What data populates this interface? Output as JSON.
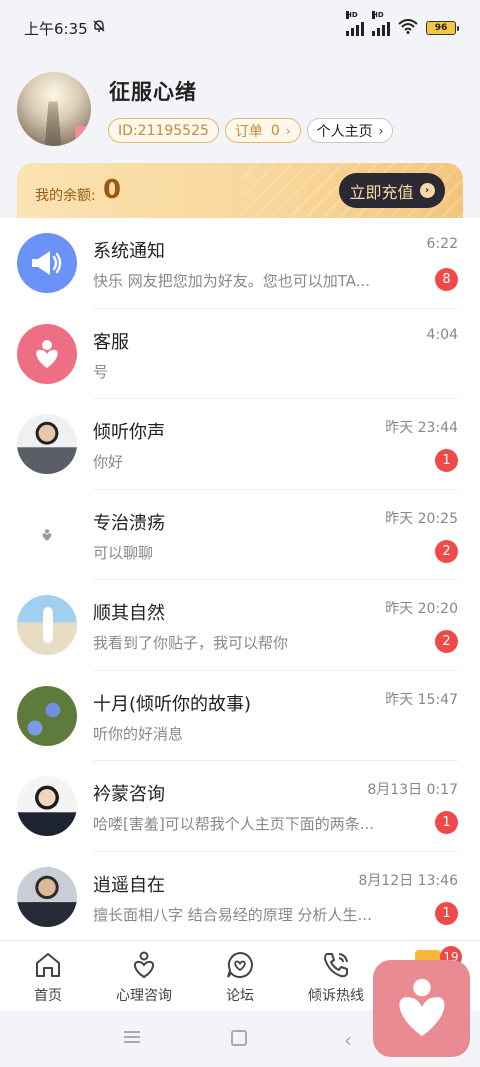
{
  "status_bar": {
    "time": "上午6:35",
    "network_1": "HD",
    "network_2": "HD",
    "battery": "96"
  },
  "profile": {
    "nickname": "征服心绪",
    "id_label": "ID:21195525",
    "order_label": "订单",
    "order_count": "0",
    "homepage_label": "个人主页"
  },
  "balance": {
    "label": "我的余额:",
    "value": "0",
    "recharge_label": "立即充值"
  },
  "conversations": [
    {
      "name": "系统通知",
      "time": "6:22",
      "preview": "快乐 网友把您加为好友。您也可以加TA...",
      "unread": "8",
      "avatar_icon": "megaphone-icon"
    },
    {
      "name": "客服",
      "time": "4:04",
      "preview": "号",
      "unread": "",
      "avatar_icon": "heart-person-icon"
    },
    {
      "name": "倾听你声",
      "time": "昨天 23:44",
      "preview": "你好",
      "unread": "1",
      "avatar_icon": "user-photo"
    },
    {
      "name": "专治溃疡",
      "time": "昨天 20:25",
      "preview": "可以聊聊",
      "unread": "2",
      "avatar_icon": "heart-person-icon"
    },
    {
      "name": "顺其自然",
      "time": "昨天 20:20",
      "preview": "我看到了你贴子，我可以帮你",
      "unread": "2",
      "avatar_icon": "user-photo"
    },
    {
      "name": "十月(倾听你的故事)",
      "time": "昨天 15:47",
      "preview": "听你的好消息",
      "unread": "",
      "avatar_icon": "user-photo"
    },
    {
      "name": "衿蒙咨询",
      "time": "8月13日 0:17",
      "preview": "哈喽[害羞]可以帮我个人主页下面的两条...",
      "unread": "1",
      "avatar_icon": "user-photo"
    },
    {
      "name": "逍遥自在",
      "time": "8月12日 13:46",
      "preview": "擅长面相八字 结合易经的原理 分析人生...",
      "unread": "1",
      "avatar_icon": "user-photo"
    }
  ],
  "tabbar": {
    "tabs": [
      {
        "label": "首页",
        "icon": "home-icon"
      },
      {
        "label": "心理咨询",
        "icon": "heart-person-icon"
      },
      {
        "label": "论坛",
        "icon": "chat-heart-icon"
      },
      {
        "label": "倾诉热线",
        "icon": "phone-icon"
      }
    ],
    "message_badge": "19"
  },
  "colors": {
    "accent_red": "#ef4a4a",
    "gold_text": "#9a5a10",
    "notify_blue": "#6b93f7",
    "service_pink": "#ee6f83"
  }
}
